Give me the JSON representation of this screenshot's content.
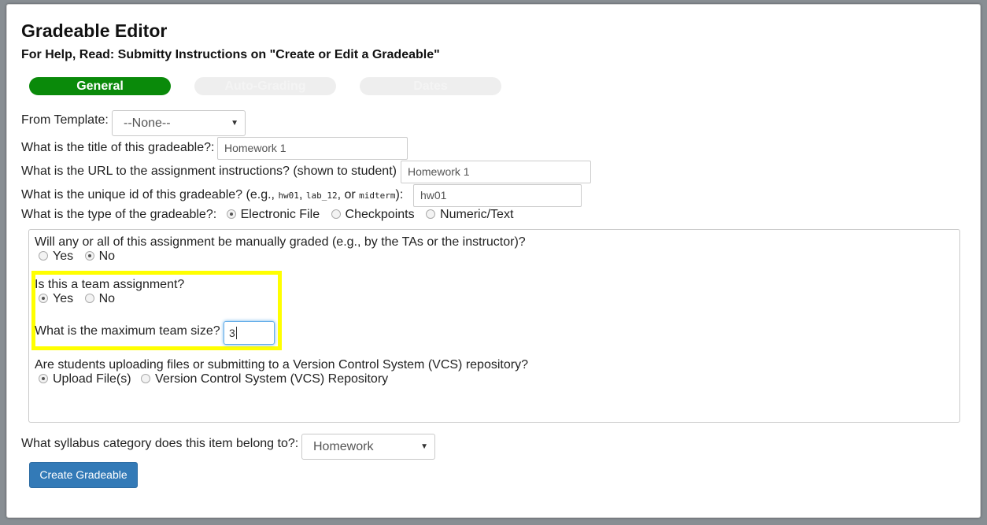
{
  "header": {
    "title": "Gradeable Editor",
    "help": "For Help, Read: Submitty Instructions on \"Create or Edit a Gradeable\""
  },
  "tabs": [
    {
      "label": "General",
      "active": true
    },
    {
      "label": "Auto-Grading",
      "active": false
    },
    {
      "label": "Dates",
      "active": false
    }
  ],
  "form": {
    "template_label": "From Template:",
    "template_value": "--None--",
    "title_label": "What is the title of this gradeable?:",
    "title_value": "Homework 1",
    "url_label": "What is the URL to the assignment instructions? (shown to student)",
    "url_value": "Homework 1",
    "id_label_prefix": "What is the unique id of this gradeable? (e.g.,",
    "id_examples": [
      "hw01",
      "lab_12",
      "midterm"
    ],
    "id_sep1": ",",
    "id_sep2": ", or",
    "id_label_suffix": "):",
    "id_value": "hw01",
    "type_label": "What is the type of the gradeable?:",
    "type_options": [
      "Electronic File",
      "Checkpoints",
      "Numeric/Text"
    ],
    "type_selected": "Electronic File"
  },
  "options": {
    "manual_question": "Will any or all of this assignment be manually graded (e.g., by the TAs or the instructor)?",
    "manual_options": [
      "Yes",
      "No"
    ],
    "manual_selected": "No",
    "team_question": "Is this a team assignment?",
    "team_options": [
      "Yes",
      "No"
    ],
    "team_selected": "Yes",
    "team_size_label": "What is the maximum team size?",
    "team_size_value": "3",
    "vcs_question": "Are students uploading files or submitting to a Version Control System (VCS) repository?",
    "vcs_options": [
      "Upload File(s)",
      "Version Control System (VCS) Repository"
    ],
    "vcs_selected": "Upload File(s)"
  },
  "syllabus": {
    "label": "What syllabus category does this item belong to?:",
    "value": "Homework"
  },
  "actions": {
    "create_label": "Create Gradeable"
  },
  "colors": {
    "active_tab": "#0a8a0a",
    "highlight": "#ffff00",
    "primary_button": "#337ab7"
  }
}
